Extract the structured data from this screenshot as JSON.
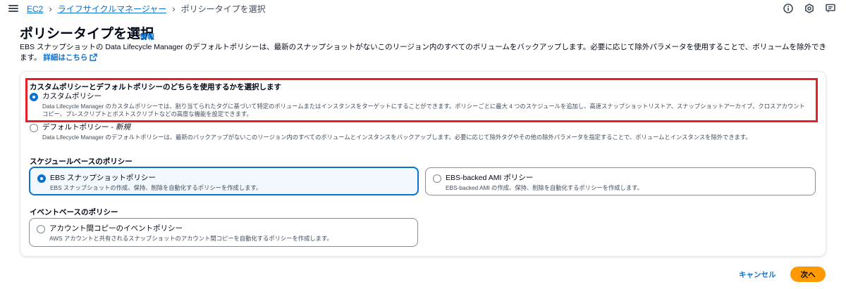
{
  "breadcrumb": {
    "items": [
      "EC2",
      "ライフサイクルマネージャー"
    ],
    "current": "ポリシータイプを選択"
  },
  "header": {
    "title": "ポリシータイプを選択",
    "info": "情報",
    "description": "EBS スナップショットの Data Lifecycle Manager のデフォルトポリシーは、最新のスナップショットがないこのリージョン内のすべてのボリュームをバックアップします。必要に応じて除外パラメータを使用することで、ボリュームを除外できます。",
    "learn_more": "詳細はこちら"
  },
  "policy_choice": {
    "label": "カスタムポリシーとデフォルトポリシーのどちらを使用するかを選択します",
    "custom": {
      "label": "カスタムポリシー",
      "description": "Data Lifecycle Manager のカスタムポリシーでは、割り当てられたタグに基づいて特定のボリュームまたはインスタンスをターゲットにすることができます。ポリシーごとに最大 4 つのスケジュールを追加し、高速スナップショットリストア、スナップショットアーカイブ、クロスアカウントコピー、プレスクリプトとポストスクリプトなどの高度な機能を設定できます。",
      "selected": true
    },
    "default": {
      "label": "デフォルトポリシー - ",
      "label_em": "新規",
      "description": "Data Lifecycle Manager のデフォルトポリシーは、最新のバックアップがないこのリージョン内のすべてのボリュームとインスタンスをバックアップします。必要に応じて除外タグやその他の除外パラメータを指定することで、ボリュームとインスタンスを除外できます。",
      "selected": false
    }
  },
  "schedule_based": {
    "label": "スケジュールベースのポリシー",
    "ebs_snapshot": {
      "label": "EBS スナップショットポリシー",
      "description": "EBS スナップショットの作成、保持、削除を自動化するポリシーを作成します。",
      "selected": true
    },
    "ebs_ami": {
      "label": "EBS-backed AMI ポリシー",
      "description": "EBS-backed AMI の作成、保持、削除を自動化するポリシーを作成します。",
      "selected": false
    }
  },
  "event_based": {
    "label": "イベントベースのポリシー",
    "cross_account": {
      "label": "アカウント間コピーのイベントポリシー",
      "description": "AWS アカウントと共有されるスナップショットのアカウント間コピーを自動化するポリシーを作成します。",
      "selected": false
    }
  },
  "footer": {
    "cancel": "キャンセル",
    "next": "次へ"
  },
  "colors": {
    "link": "#0972d3",
    "primary_button": "#ff9900",
    "highlight_border": "#e52027",
    "selected_tile_bg": "#f2f8fd"
  },
  "icons": [
    "menu-icon",
    "info-circle-icon",
    "settings-icon",
    "feedback-icon",
    "external-link-icon"
  ]
}
